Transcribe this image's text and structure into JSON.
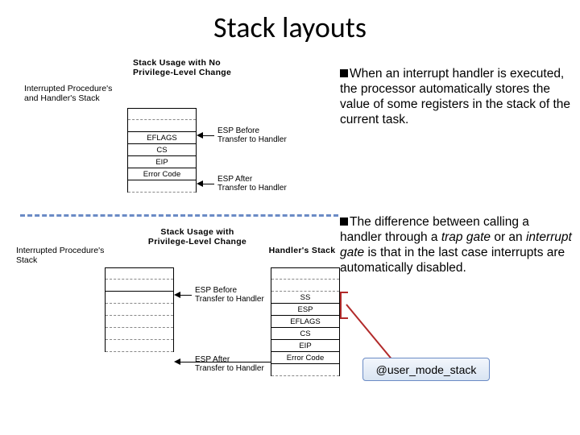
{
  "title": "Stack layouts",
  "diagram1": {
    "heading_l1": "Stack Usage with No",
    "heading_l2": "Privilege-Level Change",
    "left_label_l1": "Interrupted Procedure's",
    "left_label_l2": "and Handler's Stack",
    "rows": [
      "",
      "",
      "EFLAGS",
      "CS",
      "EIP",
      "Error Code"
    ],
    "ptr1_l1": "ESP Before",
    "ptr1_l2": "Transfer to Handler",
    "ptr2_l1": "ESP After",
    "ptr2_l2": "Transfer to Handler"
  },
  "diagram2": {
    "heading_l1": "Stack Usage with",
    "heading_l2": "Privilege-Level Change",
    "left_label_l1": "Interrupted Procedure's",
    "left_label_l2": "Stack",
    "right_label": "Handler's Stack",
    "left_rows": [
      "",
      "",
      "",
      "",
      "",
      ""
    ],
    "right_rows": [
      "SS",
      "ESP",
      "EFLAGS",
      "CS",
      "EIP",
      "Error Code"
    ],
    "ptr1_l1": "ESP Before",
    "ptr1_l2": "Transfer to Handler",
    "ptr2_l1": "ESP After",
    "ptr2_l2": "Transfer to Handler"
  },
  "para1": "When an interrupt handler is executed, the processor automatically stores the value of some registers in the stack of the current task.",
  "para2_a": "The difference between calling a handler through a ",
  "para2_trap": "trap gate",
  "para2_b": " or an ",
  "para2_int": "interrupt gate",
  "para2_c": " is that in the last case interrupts are automatically disabled.",
  "callout": "@user_mode_stack"
}
